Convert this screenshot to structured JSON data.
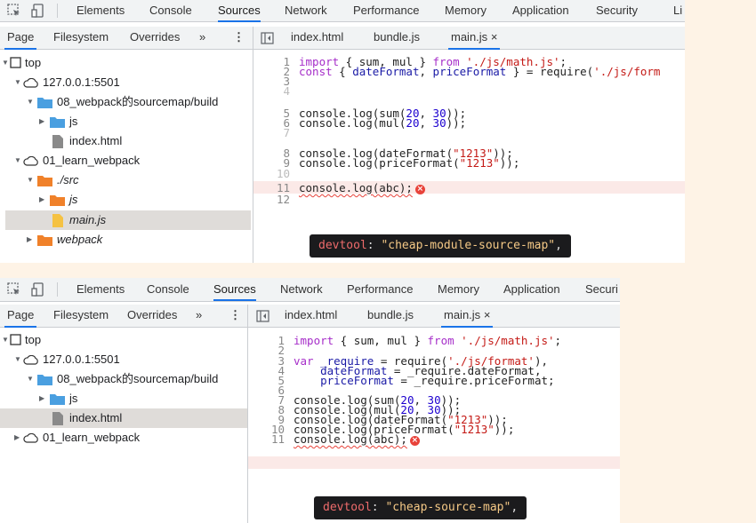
{
  "panels": [
    {
      "main_tabs": [
        "Elements",
        "Console",
        "Sources",
        "Network",
        "Performance",
        "Memory",
        "Application",
        "Security",
        "Li"
      ],
      "nav_tabs": [
        "Page",
        "Filesystem",
        "Overrides"
      ],
      "more": "»",
      "menu": "⋮",
      "file_tabs": [
        "index.html",
        "bundle.js",
        "main.js"
      ],
      "close": "×",
      "tree": [
        "top",
        "127.0.0.1:5501",
        "08_webpack的sourcemap/build",
        "js",
        "index.html",
        "01_learn_webpack",
        "./src",
        "js",
        "main.js",
        "webpack"
      ],
      "line_numbers": [
        "1",
        "2",
        "3",
        "4",
        "5",
        "6",
        "7",
        "8",
        "9",
        "10",
        "11",
        "12"
      ],
      "badge": {
        "key": "devtool",
        "colon": ": ",
        "value": "\"cheap-module-source-map\"",
        "comma": ","
      }
    },
    {
      "main_tabs": [
        "Elements",
        "Console",
        "Sources",
        "Network",
        "Performance",
        "Memory",
        "Application",
        "Securi"
      ],
      "nav_tabs": [
        "Page",
        "Filesystem",
        "Overrides"
      ],
      "more": "»",
      "menu": "⋮",
      "file_tabs": [
        "index.html",
        "bundle.js",
        "main.js"
      ],
      "close": "×",
      "tree": [
        "top",
        "127.0.0.1:5501",
        "08_webpack的sourcemap/build",
        "js",
        "index.html",
        "01_learn_webpack"
      ],
      "line_numbers": [
        "1",
        "2",
        "3",
        "4",
        "5",
        "6",
        "7",
        "8",
        "9",
        "10",
        "11"
      ],
      "badge": {
        "key": "devtool",
        "colon": ": ",
        "value": "\"cheap-source-map\"",
        "comma": ","
      }
    }
  ],
  "code1": {
    "l1": {
      "a": "import",
      "b": " { sum, mul } ",
      "c": "from",
      "d": " ",
      "e": "'./js/math.js'",
      "f": ";"
    },
    "l2": {
      "a": "const",
      "b": " { ",
      "c": "dateFormat",
      "d": ", ",
      "e": "priceFormat",
      "f": " } = require(",
      "g": "'./js/form"
    },
    "l5": {
      "a": "console.log(sum(",
      "b": "20",
      "c": ", ",
      "d": "30",
      "e": "));"
    },
    "l6": {
      "a": "console.log(mul(",
      "b": "20",
      "c": ", ",
      "d": "30",
      "e": "));"
    },
    "l8": {
      "a": "console.log(dateFormat(",
      "b": "\"1213\"",
      "c": "));"
    },
    "l9": {
      "a": "console.log(priceFormat(",
      "b": "\"1213\"",
      "c": "));"
    },
    "l11": {
      "a": "console.log(abc);"
    }
  },
  "code2": {
    "l1": {
      "a": "import",
      "b": " { sum, mul } ",
      "c": "from",
      "d": " ",
      "e": "'./js/math.js'",
      "f": ";"
    },
    "l3": {
      "a": "var",
      "b": " ",
      "c": "_require",
      "d": " = require(",
      "e": "'./js/format'",
      "f": "),"
    },
    "l4": {
      "a": "    ",
      "b": "dateFormat",
      "c": " = _require.dateFormat,"
    },
    "l5": {
      "a": "    ",
      "b": "priceFormat",
      "c": " = _require.priceFormat;"
    },
    "l7": {
      "a": "console.log(sum(",
      "b": "20",
      "c": ", ",
      "d": "30",
      "e": "));"
    },
    "l8": {
      "a": "console.log(mul(",
      "b": "20",
      "c": ", ",
      "d": "30",
      "e": "));"
    },
    "l9": {
      "a": "console.log(dateFormat(",
      "b": "\"1213\"",
      "c": "));"
    },
    "l10": {
      "a": "console.log(priceFormat(",
      "b": "\"1213\"",
      "c": "));"
    },
    "l11": {
      "a": "console.log(abc);"
    }
  },
  "colors": {
    "accent": "#1a73e8",
    "error": "#e8423a",
    "folder": "#4a9fe0",
    "folder_orange": "#f0812a",
    "file_yellow": "#f5c243"
  },
  "icons": [
    "inspect-icon",
    "device-toggle-icon",
    "sidebar-toggle-icon",
    "folder-icon",
    "cloud-icon",
    "frame-icon",
    "file-icon",
    "error-icon"
  ]
}
